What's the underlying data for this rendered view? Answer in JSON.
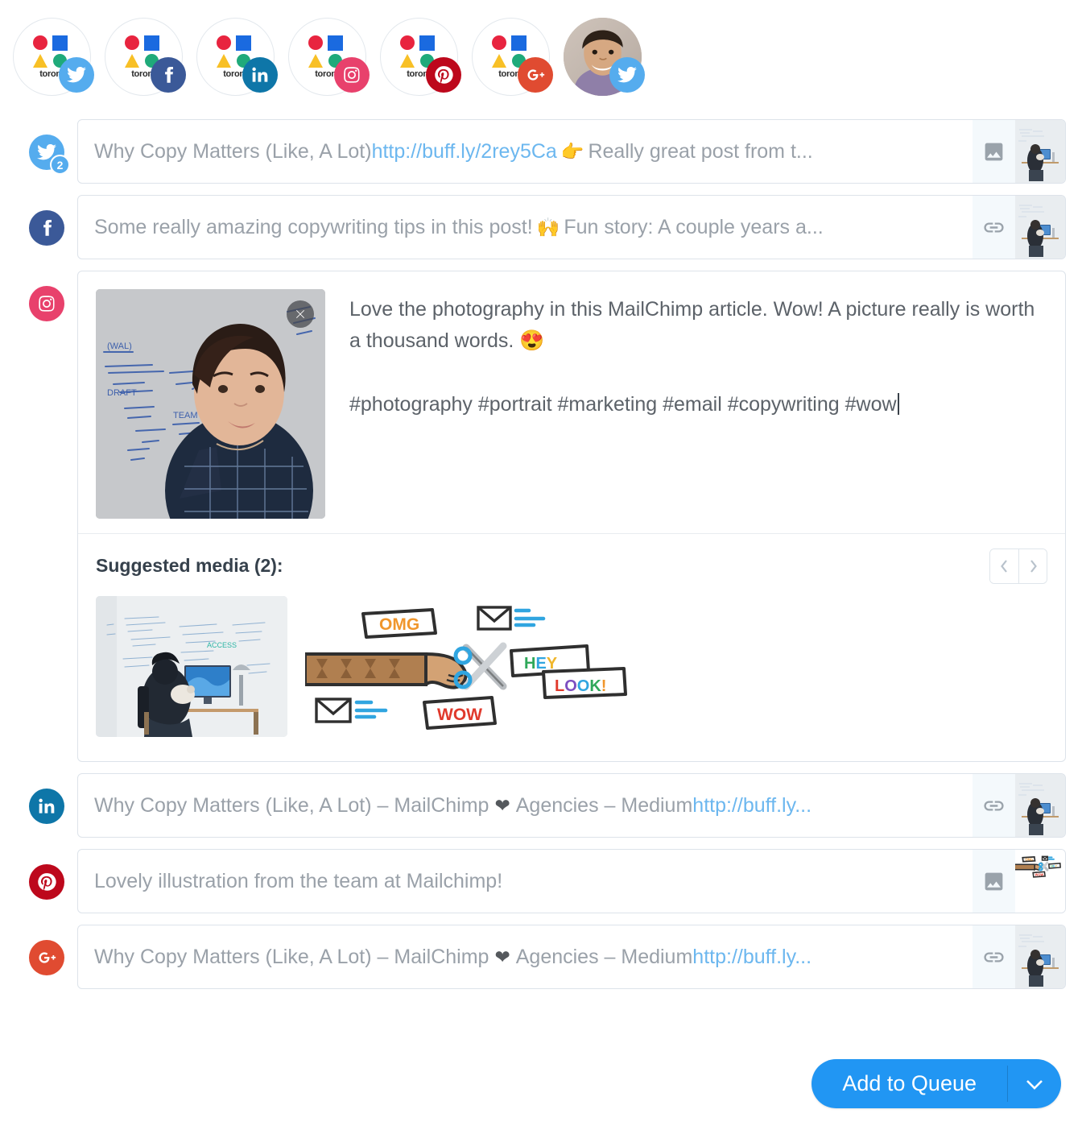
{
  "profiles": [
    {
      "name": "toronto-twitter",
      "label": "toron",
      "network": "twitter",
      "type": "logo"
    },
    {
      "name": "toronto-facebook",
      "label": "toron",
      "network": "facebook",
      "type": "logo"
    },
    {
      "name": "toronto-linkedin",
      "label": "toron",
      "network": "linkedin",
      "type": "logo"
    },
    {
      "name": "toronto-instagram",
      "label": "toron",
      "network": "instagram",
      "type": "logo"
    },
    {
      "name": "toronto-pinterest",
      "label": "toron",
      "network": "pinterest",
      "type": "logo"
    },
    {
      "name": "toronto-googleplus",
      "label": "toron",
      "network": "googleplus",
      "type": "logo"
    },
    {
      "name": "personal-twitter",
      "label": "",
      "network": "twitter",
      "type": "photo"
    }
  ],
  "composers": {
    "twitter": {
      "network": "twitter",
      "count_badge": "2",
      "text_before_link": "Why Copy Matters (Like, A Lot) ",
      "link": "http://buff.ly/2rey5Ca",
      "emoji": "👉",
      "text_after": " Really great post from t...",
      "attachment_icon": "image-icon",
      "thumbnail": "woman-cat-whiteboard"
    },
    "facebook": {
      "network": "facebook",
      "text_before": "Some really amazing copywriting tips in this post! ",
      "emoji": "🙌",
      "text_after": " Fun story: A couple years a...",
      "attachment_icon": "link-icon",
      "thumbnail": "woman-cat-whiteboard"
    },
    "instagram": {
      "network": "instagram",
      "caption_line1": "Love the photography in this MailChimp article. Wow! A picture really is worth a thousand words. ",
      "caption_emoji": "😍",
      "caption_line2": "#photography #portrait #marketing #email #copywriting #wow",
      "media_alt": "woman-portrait-whiteboard",
      "remove_media_label": "✕",
      "suggested": {
        "title": "Suggested media (2):",
        "prev_label": "‹",
        "next_label": "›",
        "items": [
          {
            "name": "woman-cat-whiteboard-photo"
          },
          {
            "name": "mailchimp-scissors-illustration",
            "words": [
              "OMG",
              "HEY",
              "LOOK!",
              "WOW"
            ]
          }
        ]
      }
    },
    "linkedin": {
      "network": "linkedin",
      "text_before_heart": "Why Copy Matters (Like, A Lot) – MailChimp ",
      "heart": "❤",
      "text_after_heart": " Agencies – Medium ",
      "link": "http://buff.ly...",
      "attachment_icon": "link-icon",
      "thumbnail": "woman-cat-whiteboard"
    },
    "pinterest": {
      "network": "pinterest",
      "text": "Lovely illustration from the team at Mailchimp!",
      "attachment_icon": "image-icon",
      "thumbnail": "mailchimp-scissors-illustration"
    },
    "googleplus": {
      "network": "googleplus",
      "text_before_heart": "Why Copy Matters (Like, A Lot) – MailChimp ",
      "heart": "❤",
      "text_after_heart": " Agencies – Medium ",
      "link": "http://buff.ly...",
      "attachment_icon": "link-icon",
      "thumbnail": "woman-cat-whiteboard"
    }
  },
  "footer": {
    "queue_label": "Add to Queue",
    "dropdown_label": "▾"
  },
  "colors": {
    "accent_blue": "#2196f3",
    "link_blue": "#6cb7ef",
    "twitter": "#55acee",
    "facebook": "#3b5998",
    "linkedin": "#0e76a8",
    "instagram": "#e8416c",
    "pinterest": "#bd081c",
    "googleplus": "#e04b31",
    "border": "#dde3ea",
    "placeholder_text": "#9aa1a9"
  }
}
